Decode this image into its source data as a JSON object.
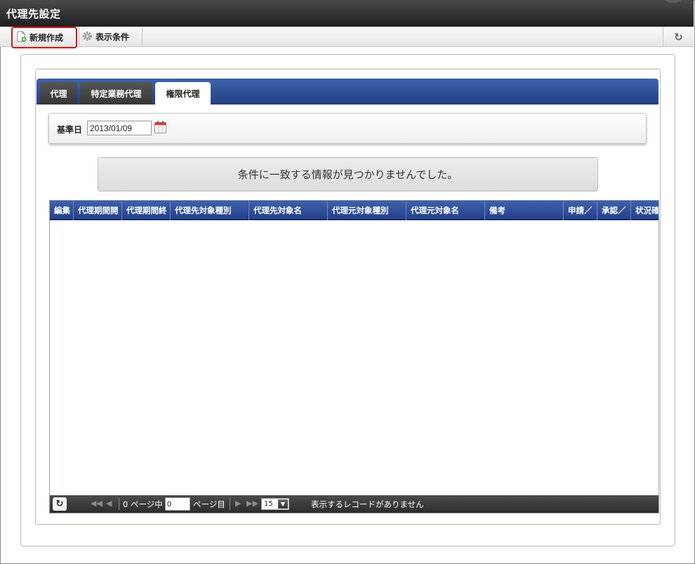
{
  "window": {
    "title": "代理先設定"
  },
  "toolbar": {
    "new_label": "新規作成",
    "conditions_label": "表示条件"
  },
  "tabs": [
    {
      "label": "代理"
    },
    {
      "label": "特定業務代理"
    },
    {
      "label": "権限代理"
    }
  ],
  "filter": {
    "date_label": "基準日",
    "date_value": "2013/01/09"
  },
  "message": "条件に一致する情報が見つかりませんでした。",
  "grid": {
    "columns": [
      "編集",
      "代理期間開",
      "代理期間終",
      "代理先対象種別",
      "代理先対象名",
      "代理元対象種別",
      "代理元対象名",
      "備考",
      "申請／",
      "承認／",
      "状況確"
    ]
  },
  "pager": {
    "page_prefix": "0 ページ中",
    "page_value": "0",
    "page_suffix": "ページ目",
    "per_page": "15",
    "status": "表示するレコードがありません"
  }
}
